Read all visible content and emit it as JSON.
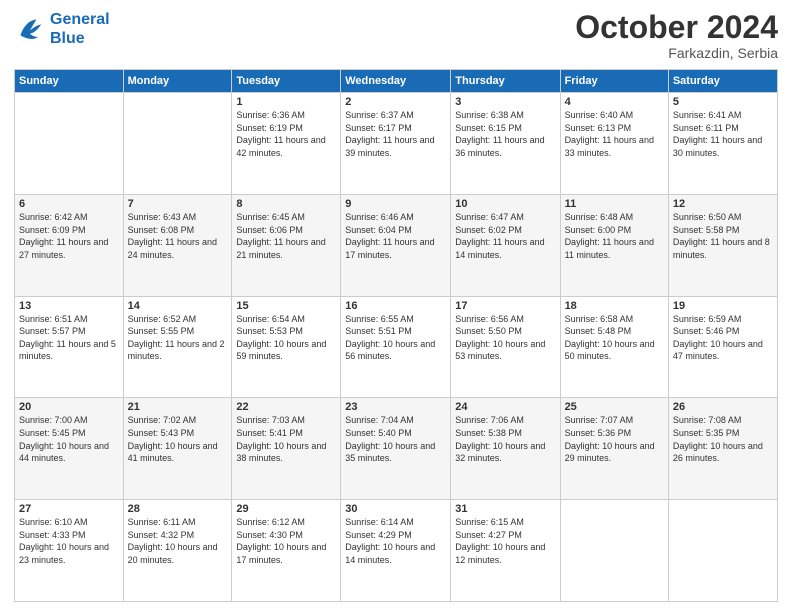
{
  "logo": {
    "line1": "General",
    "line2": "Blue"
  },
  "header": {
    "month": "October 2024",
    "location": "Farkazdin, Serbia"
  },
  "weekdays": [
    "Sunday",
    "Monday",
    "Tuesday",
    "Wednesday",
    "Thursday",
    "Friday",
    "Saturday"
  ],
  "weeks": [
    [
      {
        "day": "",
        "info": ""
      },
      {
        "day": "",
        "info": ""
      },
      {
        "day": "1",
        "info": "Sunrise: 6:36 AM\nSunset: 6:19 PM\nDaylight: 11 hours and 42 minutes."
      },
      {
        "day": "2",
        "info": "Sunrise: 6:37 AM\nSunset: 6:17 PM\nDaylight: 11 hours and 39 minutes."
      },
      {
        "day": "3",
        "info": "Sunrise: 6:38 AM\nSunset: 6:15 PM\nDaylight: 11 hours and 36 minutes."
      },
      {
        "day": "4",
        "info": "Sunrise: 6:40 AM\nSunset: 6:13 PM\nDaylight: 11 hours and 33 minutes."
      },
      {
        "day": "5",
        "info": "Sunrise: 6:41 AM\nSunset: 6:11 PM\nDaylight: 11 hours and 30 minutes."
      }
    ],
    [
      {
        "day": "6",
        "info": "Sunrise: 6:42 AM\nSunset: 6:09 PM\nDaylight: 11 hours and 27 minutes."
      },
      {
        "day": "7",
        "info": "Sunrise: 6:43 AM\nSunset: 6:08 PM\nDaylight: 11 hours and 24 minutes."
      },
      {
        "day": "8",
        "info": "Sunrise: 6:45 AM\nSunset: 6:06 PM\nDaylight: 11 hours and 21 minutes."
      },
      {
        "day": "9",
        "info": "Sunrise: 6:46 AM\nSunset: 6:04 PM\nDaylight: 11 hours and 17 minutes."
      },
      {
        "day": "10",
        "info": "Sunrise: 6:47 AM\nSunset: 6:02 PM\nDaylight: 11 hours and 14 minutes."
      },
      {
        "day": "11",
        "info": "Sunrise: 6:48 AM\nSunset: 6:00 PM\nDaylight: 11 hours and 11 minutes."
      },
      {
        "day": "12",
        "info": "Sunrise: 6:50 AM\nSunset: 5:58 PM\nDaylight: 11 hours and 8 minutes."
      }
    ],
    [
      {
        "day": "13",
        "info": "Sunrise: 6:51 AM\nSunset: 5:57 PM\nDaylight: 11 hours and 5 minutes."
      },
      {
        "day": "14",
        "info": "Sunrise: 6:52 AM\nSunset: 5:55 PM\nDaylight: 11 hours and 2 minutes."
      },
      {
        "day": "15",
        "info": "Sunrise: 6:54 AM\nSunset: 5:53 PM\nDaylight: 10 hours and 59 minutes."
      },
      {
        "day": "16",
        "info": "Sunrise: 6:55 AM\nSunset: 5:51 PM\nDaylight: 10 hours and 56 minutes."
      },
      {
        "day": "17",
        "info": "Sunrise: 6:56 AM\nSunset: 5:50 PM\nDaylight: 10 hours and 53 minutes."
      },
      {
        "day": "18",
        "info": "Sunrise: 6:58 AM\nSunset: 5:48 PM\nDaylight: 10 hours and 50 minutes."
      },
      {
        "day": "19",
        "info": "Sunrise: 6:59 AM\nSunset: 5:46 PM\nDaylight: 10 hours and 47 minutes."
      }
    ],
    [
      {
        "day": "20",
        "info": "Sunrise: 7:00 AM\nSunset: 5:45 PM\nDaylight: 10 hours and 44 minutes."
      },
      {
        "day": "21",
        "info": "Sunrise: 7:02 AM\nSunset: 5:43 PM\nDaylight: 10 hours and 41 minutes."
      },
      {
        "day": "22",
        "info": "Sunrise: 7:03 AM\nSunset: 5:41 PM\nDaylight: 10 hours and 38 minutes."
      },
      {
        "day": "23",
        "info": "Sunrise: 7:04 AM\nSunset: 5:40 PM\nDaylight: 10 hours and 35 minutes."
      },
      {
        "day": "24",
        "info": "Sunrise: 7:06 AM\nSunset: 5:38 PM\nDaylight: 10 hours and 32 minutes."
      },
      {
        "day": "25",
        "info": "Sunrise: 7:07 AM\nSunset: 5:36 PM\nDaylight: 10 hours and 29 minutes."
      },
      {
        "day": "26",
        "info": "Sunrise: 7:08 AM\nSunset: 5:35 PM\nDaylight: 10 hours and 26 minutes."
      }
    ],
    [
      {
        "day": "27",
        "info": "Sunrise: 6:10 AM\nSunset: 4:33 PM\nDaylight: 10 hours and 23 minutes."
      },
      {
        "day": "28",
        "info": "Sunrise: 6:11 AM\nSunset: 4:32 PM\nDaylight: 10 hours and 20 minutes."
      },
      {
        "day": "29",
        "info": "Sunrise: 6:12 AM\nSunset: 4:30 PM\nDaylight: 10 hours and 17 minutes."
      },
      {
        "day": "30",
        "info": "Sunrise: 6:14 AM\nSunset: 4:29 PM\nDaylight: 10 hours and 14 minutes."
      },
      {
        "day": "31",
        "info": "Sunrise: 6:15 AM\nSunset: 4:27 PM\nDaylight: 10 hours and 12 minutes."
      },
      {
        "day": "",
        "info": ""
      },
      {
        "day": "",
        "info": ""
      }
    ]
  ]
}
